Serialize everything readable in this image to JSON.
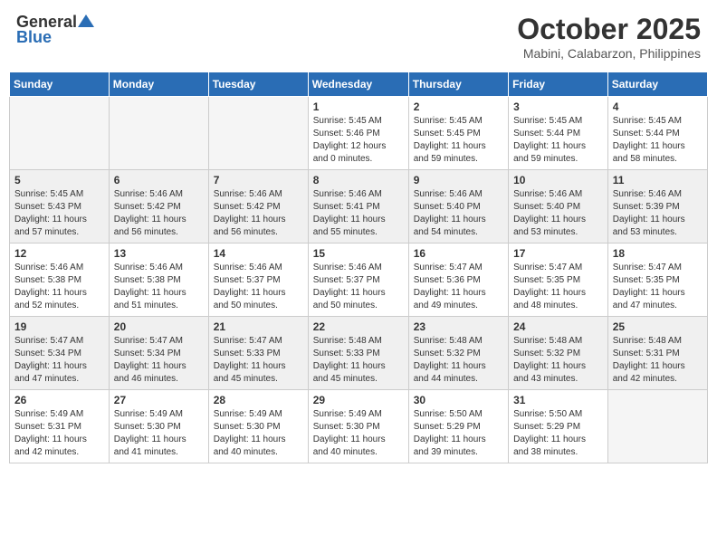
{
  "header": {
    "logo_general": "General",
    "logo_blue": "Blue",
    "month_title": "October 2025",
    "location": "Mabini, Calabarzon, Philippines"
  },
  "weekdays": [
    "Sunday",
    "Monday",
    "Tuesday",
    "Wednesday",
    "Thursday",
    "Friday",
    "Saturday"
  ],
  "weeks": [
    [
      {
        "day": "",
        "info": ""
      },
      {
        "day": "",
        "info": ""
      },
      {
        "day": "",
        "info": ""
      },
      {
        "day": "1",
        "info": "Sunrise: 5:45 AM\nSunset: 5:46 PM\nDaylight: 12 hours\nand 0 minutes."
      },
      {
        "day": "2",
        "info": "Sunrise: 5:45 AM\nSunset: 5:45 PM\nDaylight: 11 hours\nand 59 minutes."
      },
      {
        "day": "3",
        "info": "Sunrise: 5:45 AM\nSunset: 5:44 PM\nDaylight: 11 hours\nand 59 minutes."
      },
      {
        "day": "4",
        "info": "Sunrise: 5:45 AM\nSunset: 5:44 PM\nDaylight: 11 hours\nand 58 minutes."
      }
    ],
    [
      {
        "day": "5",
        "info": "Sunrise: 5:45 AM\nSunset: 5:43 PM\nDaylight: 11 hours\nand 57 minutes."
      },
      {
        "day": "6",
        "info": "Sunrise: 5:46 AM\nSunset: 5:42 PM\nDaylight: 11 hours\nand 56 minutes."
      },
      {
        "day": "7",
        "info": "Sunrise: 5:46 AM\nSunset: 5:42 PM\nDaylight: 11 hours\nand 56 minutes."
      },
      {
        "day": "8",
        "info": "Sunrise: 5:46 AM\nSunset: 5:41 PM\nDaylight: 11 hours\nand 55 minutes."
      },
      {
        "day": "9",
        "info": "Sunrise: 5:46 AM\nSunset: 5:40 PM\nDaylight: 11 hours\nand 54 minutes."
      },
      {
        "day": "10",
        "info": "Sunrise: 5:46 AM\nSunset: 5:40 PM\nDaylight: 11 hours\nand 53 minutes."
      },
      {
        "day": "11",
        "info": "Sunrise: 5:46 AM\nSunset: 5:39 PM\nDaylight: 11 hours\nand 53 minutes."
      }
    ],
    [
      {
        "day": "12",
        "info": "Sunrise: 5:46 AM\nSunset: 5:38 PM\nDaylight: 11 hours\nand 52 minutes."
      },
      {
        "day": "13",
        "info": "Sunrise: 5:46 AM\nSunset: 5:38 PM\nDaylight: 11 hours\nand 51 minutes."
      },
      {
        "day": "14",
        "info": "Sunrise: 5:46 AM\nSunset: 5:37 PM\nDaylight: 11 hours\nand 50 minutes."
      },
      {
        "day": "15",
        "info": "Sunrise: 5:46 AM\nSunset: 5:37 PM\nDaylight: 11 hours\nand 50 minutes."
      },
      {
        "day": "16",
        "info": "Sunrise: 5:47 AM\nSunset: 5:36 PM\nDaylight: 11 hours\nand 49 minutes."
      },
      {
        "day": "17",
        "info": "Sunrise: 5:47 AM\nSunset: 5:35 PM\nDaylight: 11 hours\nand 48 minutes."
      },
      {
        "day": "18",
        "info": "Sunrise: 5:47 AM\nSunset: 5:35 PM\nDaylight: 11 hours\nand 47 minutes."
      }
    ],
    [
      {
        "day": "19",
        "info": "Sunrise: 5:47 AM\nSunset: 5:34 PM\nDaylight: 11 hours\nand 47 minutes."
      },
      {
        "day": "20",
        "info": "Sunrise: 5:47 AM\nSunset: 5:34 PM\nDaylight: 11 hours\nand 46 minutes."
      },
      {
        "day": "21",
        "info": "Sunrise: 5:47 AM\nSunset: 5:33 PM\nDaylight: 11 hours\nand 45 minutes."
      },
      {
        "day": "22",
        "info": "Sunrise: 5:48 AM\nSunset: 5:33 PM\nDaylight: 11 hours\nand 45 minutes."
      },
      {
        "day": "23",
        "info": "Sunrise: 5:48 AM\nSunset: 5:32 PM\nDaylight: 11 hours\nand 44 minutes."
      },
      {
        "day": "24",
        "info": "Sunrise: 5:48 AM\nSunset: 5:32 PM\nDaylight: 11 hours\nand 43 minutes."
      },
      {
        "day": "25",
        "info": "Sunrise: 5:48 AM\nSunset: 5:31 PM\nDaylight: 11 hours\nand 42 minutes."
      }
    ],
    [
      {
        "day": "26",
        "info": "Sunrise: 5:49 AM\nSunset: 5:31 PM\nDaylight: 11 hours\nand 42 minutes."
      },
      {
        "day": "27",
        "info": "Sunrise: 5:49 AM\nSunset: 5:30 PM\nDaylight: 11 hours\nand 41 minutes."
      },
      {
        "day": "28",
        "info": "Sunrise: 5:49 AM\nSunset: 5:30 PM\nDaylight: 11 hours\nand 40 minutes."
      },
      {
        "day": "29",
        "info": "Sunrise: 5:49 AM\nSunset: 5:30 PM\nDaylight: 11 hours\nand 40 minutes."
      },
      {
        "day": "30",
        "info": "Sunrise: 5:50 AM\nSunset: 5:29 PM\nDaylight: 11 hours\nand 39 minutes."
      },
      {
        "day": "31",
        "info": "Sunrise: 5:50 AM\nSunset: 5:29 PM\nDaylight: 11 hours\nand 38 minutes."
      },
      {
        "day": "",
        "info": ""
      }
    ]
  ]
}
